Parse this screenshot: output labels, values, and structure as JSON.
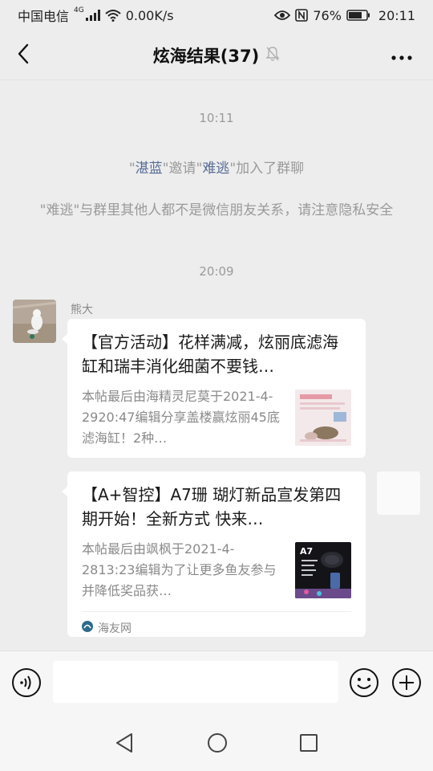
{
  "status_bar": {
    "carrier": "中国电信",
    "network": "4G",
    "speed": "0.00K/s",
    "battery": "76%",
    "time": "20:11",
    "icons": [
      "signal-icon",
      "wifi-icon",
      "eye-icon",
      "nfc-icon",
      "battery-icon"
    ]
  },
  "header": {
    "title": "炫海结果(37)",
    "icons": [
      "back-arrow-icon",
      "mute-bell-icon",
      "more-dots-icon"
    ]
  },
  "messages": {
    "time_1": "10:11",
    "invite": {
      "quote_open": "\"",
      "inviter": "湛蓝",
      "middle": "\"邀请\"",
      "invitee": "难逃",
      "suffix": "\"加入了群聊"
    },
    "warning": "\"难逃\"与群里其他人都不是微信朋友关系，请注意隐私安全",
    "time_2": "20:09",
    "sender_name": "熊大",
    "cards": [
      {
        "title": "【官方活动】花样满减，炫丽底滤海缸和瑞丰消化细菌不要钱…",
        "desc": "本帖最后由海精灵尼莫于2021-4-2920:47编辑分享盖楼赢炫丽45底滤海缸！2种…",
        "source": ""
      },
      {
        "title": "【A+智控】A7珊 瑚灯新品宣发第四期开始！全新方式 快来…",
        "desc": "本帖最后由飒枫于2021-4-2813:23编辑为了让更多鱼友参与并降低奖品获…",
        "source": "海友网",
        "thumb_label": "A7"
      }
    ]
  },
  "input_bar": {
    "placeholder": "",
    "icons": [
      "voice-icon",
      "emoji-icon",
      "plus-icon"
    ]
  },
  "nav_bar": {
    "icons": [
      "nav-back-icon",
      "nav-home-icon",
      "nav-recent-icon"
    ]
  },
  "colors": {
    "background": "#ededed",
    "link": "#576b95",
    "system_text": "#9a9a9a"
  }
}
